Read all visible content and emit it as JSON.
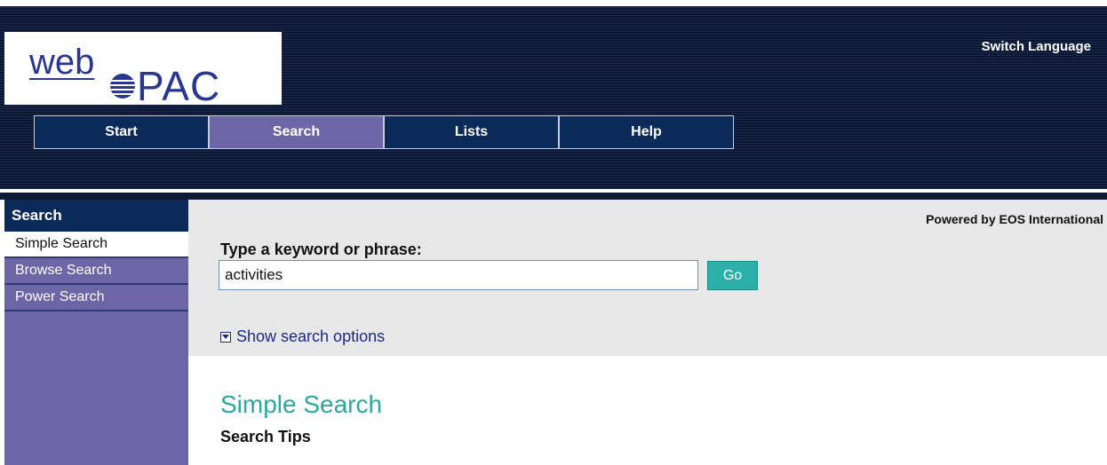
{
  "logo": {
    "web": "web",
    "pac": "PAC",
    "mark_icon": "opac-globe-icon"
  },
  "header": {
    "switch_language": "Switch Language"
  },
  "nav": {
    "tabs": [
      "Start",
      "Search",
      "Lists",
      "Help"
    ],
    "active": "Search"
  },
  "sidebar": {
    "title": "Search",
    "items": [
      "Simple Search",
      "Browse Search",
      "Power Search"
    ],
    "active": "Simple Search"
  },
  "search": {
    "powered_by": "Powered by EOS International",
    "prompt": "Type a keyword or phrase:",
    "value": "activities",
    "go_label": "Go",
    "options_label": "Show search options",
    "options_icon": "expand-triangle-icon"
  },
  "content": {
    "title": "Simple Search",
    "subtitle": "Search Tips"
  },
  "colors": {
    "header_bg": "#0d1a36",
    "nav_tab": "#0a2a5a",
    "active_tab": "#6c66a6",
    "sidebar": "#6c66a6",
    "accent_teal": "#2ab0a8",
    "logo_blue": "#29378f"
  }
}
